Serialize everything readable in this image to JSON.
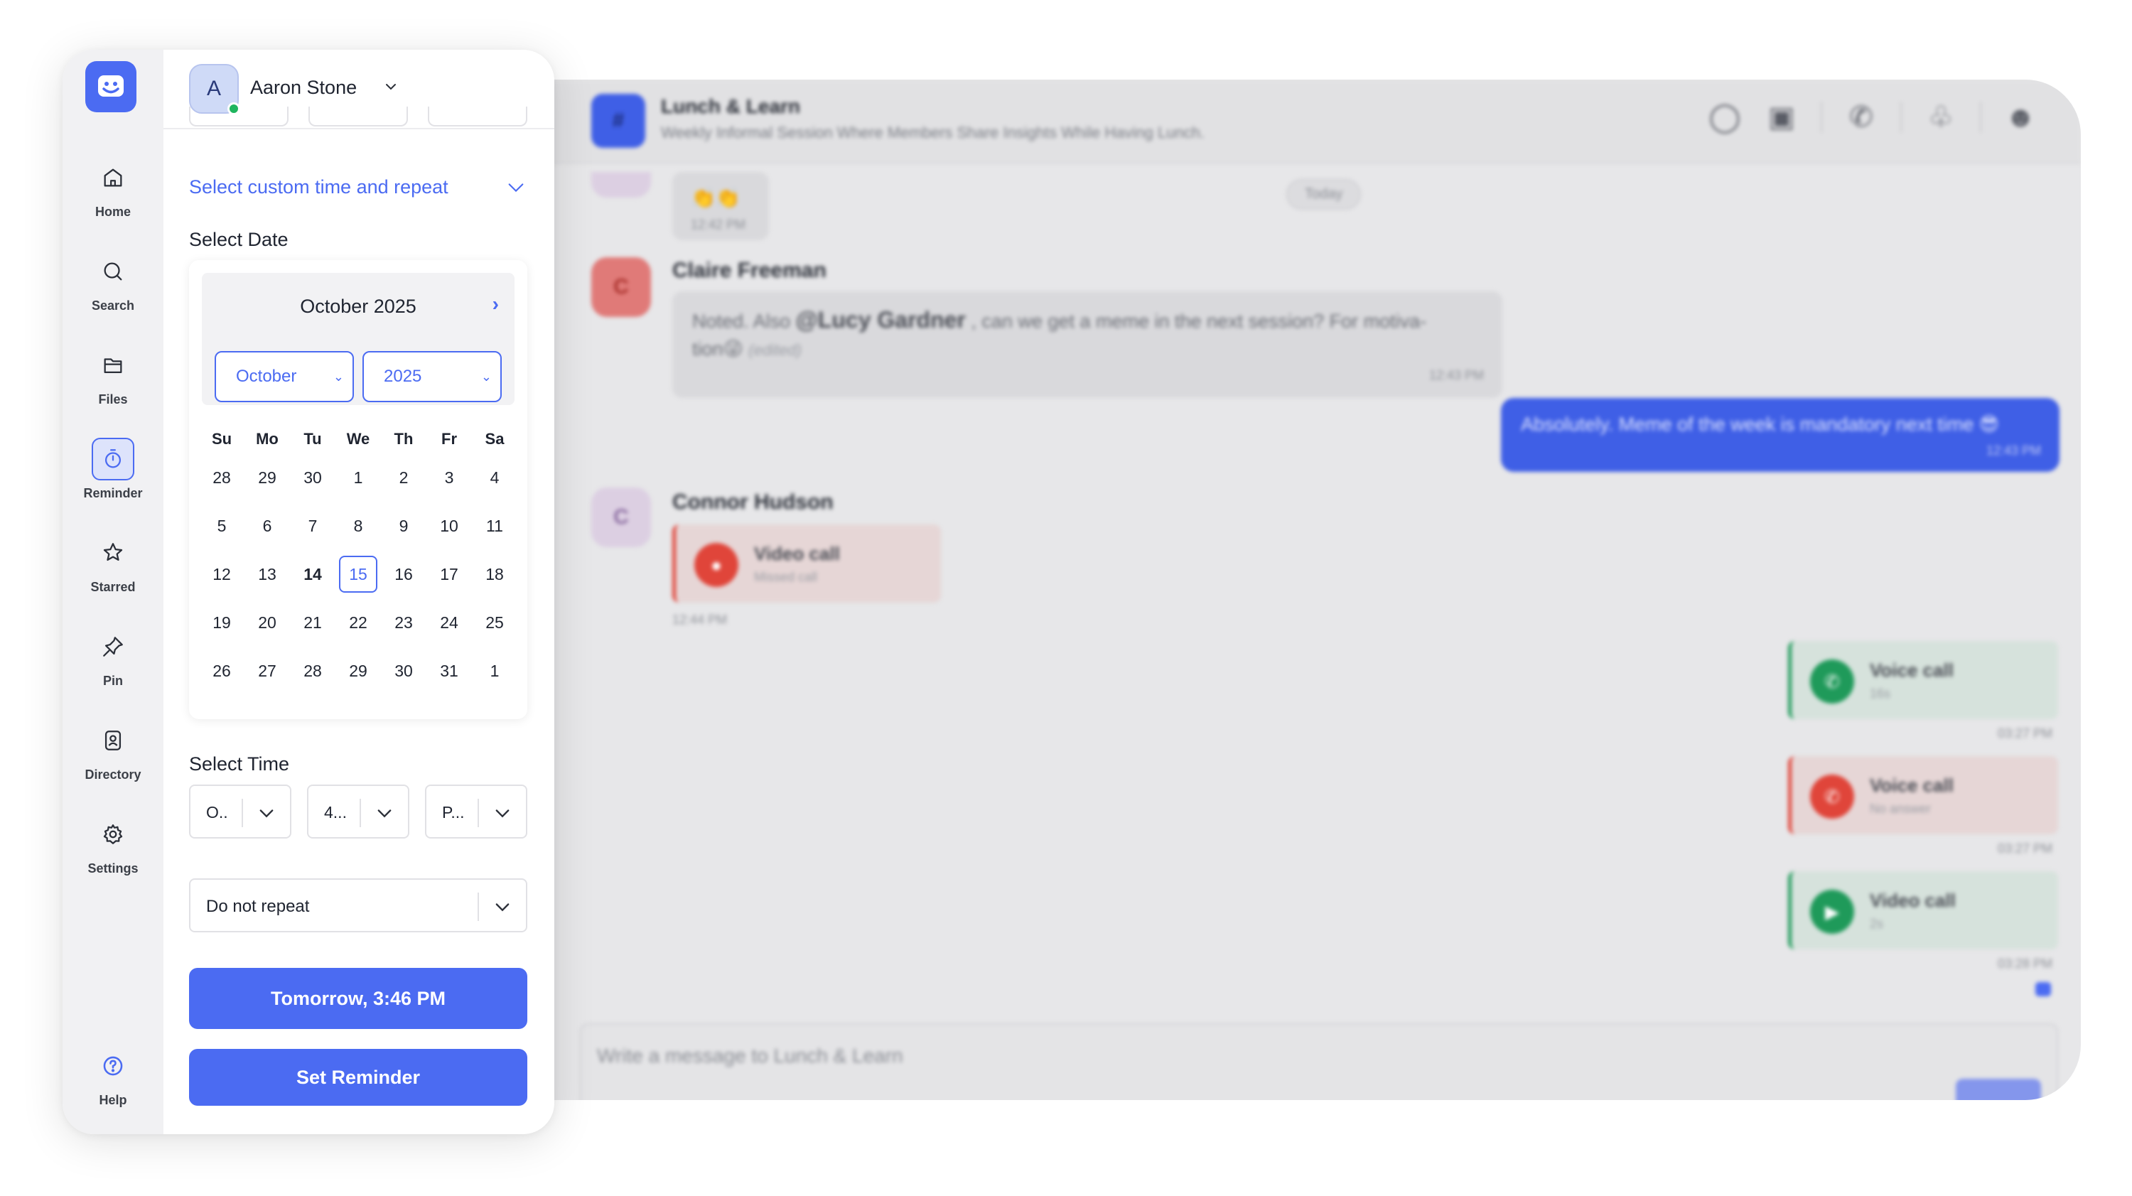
{
  "chat": {
    "channel_icon": "#",
    "channel_name": "Lunch & Learn",
    "channel_desc": "Weekly Informal Session Where Members Share Insights While Having Lunch.",
    "icons": [
      "search-icon",
      "video-icon",
      "phone-icon",
      "bell-icon",
      "user-icon"
    ],
    "today_label": "Today",
    "top_message": {
      "emoji": "👏👏",
      "time": "12:42 PM"
    },
    "claire": {
      "initial": "C",
      "name": "Claire Freeman",
      "text_before": "Noted. Also ",
      "mention": "@Lucy Gardner",
      "text_after": " , can we get a meme in the next session? For motiva-",
      "text_line2": "tion😜",
      "edited": "(edited)",
      "time": "12:43 PM"
    },
    "outgoing": {
      "text": "Absolutely. Meme of the week is mandatory next time 😎",
      "time": "12:43 PM"
    },
    "connor": {
      "initial": "C",
      "name": "Connor Hudson",
      "call_title": "Video call",
      "call_sub": "Missed call",
      "time": "12:44 PM"
    },
    "calls": [
      {
        "title": "Voice call",
        "sub": "16s",
        "time": "03:27 PM",
        "color": "#1f9a5a",
        "bg": "#d6e2dc"
      },
      {
        "title": "Voice call",
        "sub": "No answer",
        "time": "03:27 PM",
        "color": "#e0453a",
        "bg": "#e6d6d6"
      },
      {
        "title": "Video call",
        "sub": "2s",
        "time": "03:28 PM",
        "color": "#1f9a5a",
        "bg": "#d6e2dc"
      }
    ],
    "composer_placeholder": "Write a message to Lunch & Learn"
  },
  "sidebar": {
    "items": [
      {
        "label": "Home",
        "icon": "home-icon"
      },
      {
        "label": "Search",
        "icon": "search-icon"
      },
      {
        "label": "Files",
        "icon": "folder-icon"
      },
      {
        "label": "Reminder",
        "icon": "timer-icon",
        "active": true
      },
      {
        "label": "Starred",
        "icon": "star-icon"
      },
      {
        "label": "Pin",
        "icon": "pin-icon"
      },
      {
        "label": "Directory",
        "icon": "contact-icon"
      },
      {
        "label": "Settings",
        "icon": "gear-icon"
      }
    ],
    "help_label": "Help"
  },
  "user": {
    "initial": "A",
    "name": "Aaron Stone"
  },
  "reminder": {
    "custom_time_label": "Select custom time and repeat",
    "select_date_label": "Select Date",
    "calendar": {
      "title": "October 2025",
      "month_value": "October",
      "year_value": "2025",
      "weekdays": [
        "Su",
        "Mo",
        "Tu",
        "We",
        "Th",
        "Fr",
        "Sa"
      ],
      "weeks": [
        [
          "28",
          "29",
          "30",
          "1",
          "2",
          "3",
          "4"
        ],
        [
          "5",
          "6",
          "7",
          "8",
          "9",
          "10",
          "11"
        ],
        [
          "12",
          "13",
          "14",
          "15",
          "16",
          "17",
          "18"
        ],
        [
          "19",
          "20",
          "21",
          "22",
          "23",
          "24",
          "25"
        ],
        [
          "26",
          "27",
          "28",
          "29",
          "30",
          "31",
          "1"
        ]
      ],
      "today": "14",
      "selected": "15"
    },
    "select_time_label": "Select Time",
    "hour_value": "O..",
    "minute_value": "4...",
    "period_value": "P...",
    "repeat_value": "Do not repeat",
    "tomorrow_button": "Tomorrow, 3:46 PM",
    "set_button": "Set Reminder"
  },
  "colors": {
    "accent": "#4b6bf2",
    "online": "#1fb55e",
    "missed": "#e0453a"
  }
}
